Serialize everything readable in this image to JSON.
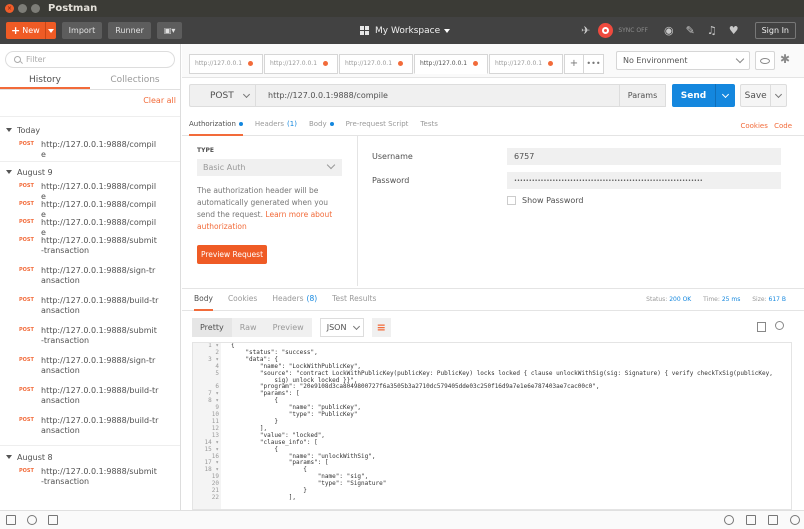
{
  "window": {
    "title": "Postman"
  },
  "toolbar": {
    "new_label": "New",
    "import_label": "Import",
    "runner_label": "Runner",
    "workspace_label": "My Workspace",
    "sync_label": "SYNC OFF",
    "signin_label": "Sign In"
  },
  "sidebar": {
    "filter_placeholder": "Filter",
    "tabs": [
      "History",
      "Collections"
    ],
    "clear_all": "Clear all",
    "groups": [
      {
        "title": "Today",
        "items": [
          {
            "method": "POST",
            "url": "http://127.0.0.1:9888/compile"
          }
        ]
      },
      {
        "title": "August 9",
        "items": [
          {
            "method": "POST",
            "url": "http://127.0.0.1:9888/compile"
          },
          {
            "method": "POST",
            "url": "http://127.0.0.1:9888/compile"
          },
          {
            "method": "POST",
            "url": "http://127.0.0.1:9888/compile"
          },
          {
            "method": "POST",
            "url": "http://127.0.0.1:9888/submit-transaction"
          },
          {
            "method": "POST",
            "url": "http://127.0.0.1:9888/sign-transaction"
          },
          {
            "method": "POST",
            "url": "http://127.0.0.1:9888/build-transaction"
          },
          {
            "method": "POST",
            "url": "http://127.0.0.1:9888/submit-transaction"
          },
          {
            "method": "POST",
            "url": "http://127.0.0.1:9888/sign-transaction"
          },
          {
            "method": "POST",
            "url": "http://127.0.0.1:9888/build-transaction"
          },
          {
            "method": "POST",
            "url": "http://127.0.0.1:9888/build-transaction"
          }
        ]
      },
      {
        "title": "August 8",
        "items": [
          {
            "method": "POST",
            "url": "http://127.0.0.1:9888/submit-transaction"
          }
        ]
      }
    ]
  },
  "request_tabs": [
    {
      "label": "http://127.0.0.1"
    },
    {
      "label": "http://127.0.0.1"
    },
    {
      "label": "http://127.0.0.1"
    },
    {
      "label": "http://127.0.0.1"
    },
    {
      "label": "http://127.0.0.1"
    }
  ],
  "environment": {
    "selected": "No Environment"
  },
  "request": {
    "method": "POST",
    "url": "http://127.0.0.1:9888/compile",
    "params_label": "Params",
    "send_label": "Send",
    "save_label": "Save"
  },
  "req_tabs": {
    "authorization": "Authorization",
    "headers": "Headers",
    "headers_count": "(1)",
    "body": "Body",
    "prerequest": "Pre-request Script",
    "tests": "Tests",
    "cookies": "Cookies",
    "code": "Code"
  },
  "auth": {
    "type_label": "TYPE",
    "type_value": "Basic Auth",
    "description": "The authorization header will be automatically generated when you send the request.",
    "learn_more": "Learn more about authorization",
    "preview_label": "Preview Request",
    "username_label": "Username",
    "username_value": "6757",
    "password_label": "Password",
    "password_value": "••••••••••••••••••••••••••••••••••••••••••••••••••••••••••••••••",
    "show_password": "Show Password"
  },
  "response": {
    "tabs": {
      "body": "Body",
      "cookies": "Cookies",
      "headers": "Headers",
      "headers_count": "(8)",
      "tests": "Test Results"
    },
    "status_label": "Status:",
    "status_value": "200 OK",
    "time_label": "Time:",
    "time_value": "25 ms",
    "size_label": "Size:",
    "size_value": "617 B",
    "formats": [
      "Pretty",
      "Raw",
      "Preview"
    ],
    "json_label": "JSON",
    "line_numbers": [
      "1 ▾",
      "2",
      "3 ▾",
      "4",
      "5",
      "",
      "6",
      "7 ▾",
      "8 ▾",
      "9",
      "10",
      "11",
      "12",
      "13",
      "14 ▾",
      "15 ▾",
      "16",
      "17 ▾",
      "18 ▾",
      "19",
      "20",
      "21",
      "22"
    ],
    "code_lines": [
      "{",
      "    \"status\": \"success\",",
      "    \"data\": {",
      "        \"name\": \"LockWithPublicKey\",",
      "        \"source\": \"contract LockWithPublicKey(publicKey: PublicKey) locks locked { clause unlockWithSig(sig: Signature) { verify checkTxSig(publicKey,",
      "            sig) unlock locked }}\",",
      "        \"program\": \"20e9108d3ca8049800727f6a3505b3a2710dc579405dde03c250f16d9a7e1e6e787403ae7cac00c0\",",
      "        \"params\": [",
      "            {",
      "                \"name\": \"publicKey\",",
      "                \"type\": \"PublicKey\"",
      "            }",
      "        ],",
      "        \"value\": \"locked\",",
      "        \"clause_info\": [",
      "            {",
      "                \"name\": \"unlockWithSig\",",
      "                \"params\": [",
      "                    {",
      "                        \"name\": \"sig\",",
      "                        \"type\": \"Signature\"",
      "                    }",
      "                ],"
    ]
  }
}
